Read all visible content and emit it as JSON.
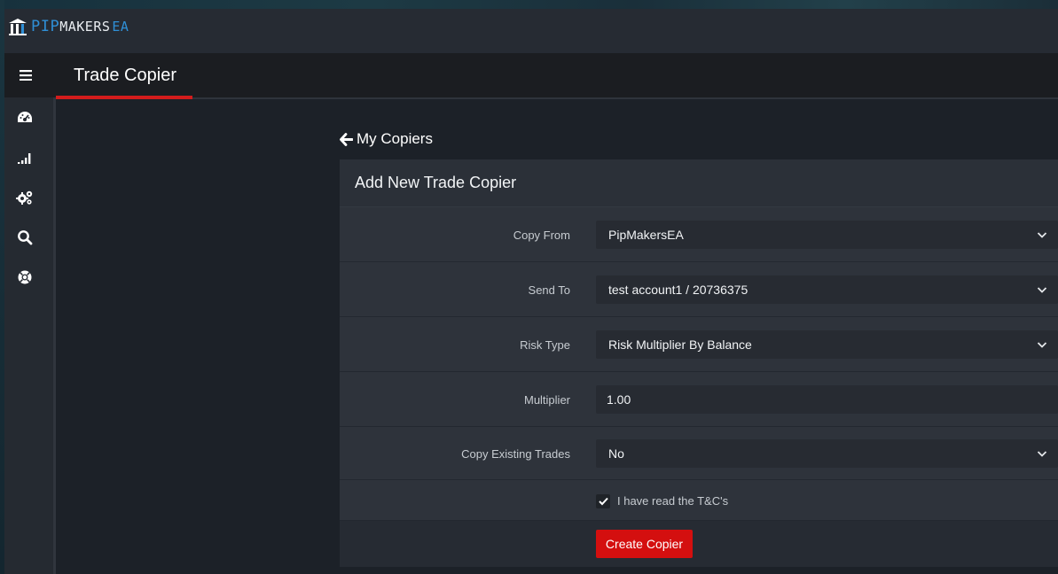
{
  "brand": {
    "logo_pip": "PIP",
    "logo_makers": "MAKERS",
    "logo_ea": "EA"
  },
  "header": {
    "menu_icon": "hamburger-icon",
    "title": "Trade Copier"
  },
  "sidebar": {
    "items": [
      {
        "icon": "dashboard-gauge-icon"
      },
      {
        "icon": "signal-bars-icon"
      },
      {
        "icon": "cogs-icon"
      },
      {
        "icon": "search-icon"
      },
      {
        "icon": "lifebuoy-icon"
      }
    ]
  },
  "back_link": {
    "icon": "arrow-left-icon",
    "label": "My Copiers"
  },
  "panel": {
    "title": "Add New Trade Copier",
    "fields": [
      {
        "label": "Copy From",
        "value": "PipMakersEA",
        "type": "select"
      },
      {
        "label": "Send To",
        "value": "test account1 / 20736375",
        "type": "select"
      },
      {
        "label": "Risk Type",
        "value": "Risk Multiplier By Balance",
        "type": "select"
      },
      {
        "label": "Multiplier",
        "value": "1.00",
        "type": "input"
      },
      {
        "label": "Copy Existing Trades",
        "value": "No",
        "type": "select"
      }
    ],
    "terms": {
      "checked": true,
      "label": "I have read the T&C's"
    },
    "submit_label": "Create Copier"
  },
  "colors": {
    "accent_red": "#d40f0f",
    "brand_blue": "#2f8fd6",
    "panel_bg": "#2e333b"
  }
}
